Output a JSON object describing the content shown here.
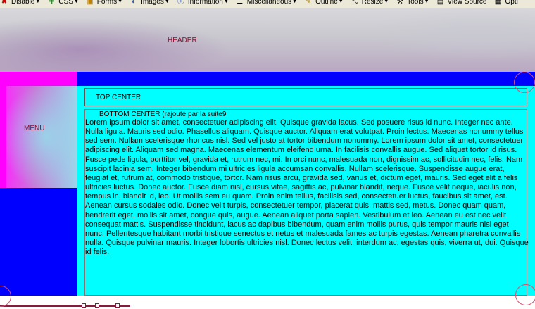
{
  "toolbar": {
    "items": [
      {
        "label": "Disable",
        "icon": "disable-icon"
      },
      {
        "label": "CSS",
        "icon": "css-icon"
      },
      {
        "label": "Forms",
        "icon": "forms-icon"
      },
      {
        "label": "Images",
        "icon": "images-icon"
      },
      {
        "label": "Information",
        "icon": "information-icon"
      },
      {
        "label": "Miscellaneous",
        "icon": "miscellaneous-icon"
      },
      {
        "label": "Outline",
        "icon": "outline-icon"
      },
      {
        "label": "Resize",
        "icon": "resize-icon"
      },
      {
        "label": "Tools",
        "icon": "tools-icon"
      },
      {
        "label": "View Source",
        "icon": "view-source-icon"
      },
      {
        "label": "Opti",
        "icon": "options-icon"
      }
    ]
  },
  "header": {
    "label": "HEADER"
  },
  "menu": {
    "label": "MENU"
  },
  "top_center": {
    "label": "TOP CENTER"
  },
  "bottom_center": {
    "title": "BOTTOM CENTER (rajouté par la suite9",
    "text": "Lorem ipsum dolor sit amet, consectetuer adipiscing elit. Quisque gravida lacus. Sed posuere risus id nunc. Integer nec ante. Nulla ligula. Mauris sed odio. Phasellus aliquam. Quisque auctor. Aliquam erat volutpat. Proin lectus. Maecenas nonummy tellus sed sem. Nullam scelerisque rhoncus nisl. Sed vel justo at tortor bibendum nonummy. Lorem ipsum dolor sit amet, consectetuer adipiscing elit. Aliquam sed magna. Maecenas elementum eleifend urna. In facilisis convallis augue. Sed aliquet tortor id risus. Fusce pede ligula, porttitor vel, gravida et, rutrum nec, mi. In orci nunc, malesuada non, dignissim ac, sollicitudin nec, felis. Nam suscipit lacinia sem. Integer bibendum mi ultricies ligula accumsan convallis. Nullam scelerisque. Suspendisse augue erat, feugiat et, rutrum at, commodo tristique, tortor. Nam risus arcu, gravida sed, varius et, dictum eget, mauris. Sed eget elit a felis ultricies luctus. Donec auctor. Fusce diam nisl, cursus vitae, sagittis ac, pulvinar blandit, neque. Fusce velit neque, iaculis non, tempus in, blandit id, leo. Ut mollis sem eu quam. Proin enim tellus, facilisis sed, consectetuer luctus, faucibus sit amet, est. Aenean cursus sodales odio. Donec velit turpis, consectetuer tempor, placerat quis, mattis sed, metus. Donec quam quam, hendrerit eget, mollis sit amet, congue quis, augue. Aenean aliquet porta sapien. Vestibulum et leo. Aenean eu est nec velit consequat mattis. Suspendisse tincidunt, lacus ac dapibus bibendum, quam enim mollis purus, quis tempor mauris nisl eget nunc. Pellentesque habitant morbi tristique senectus et netus et malesuada fames ac turpis egestas. Aenean pharetra convallis nulla. Quisque pulvinar mauris. Integer lobortis ultricies nisl. Donec lectus velit, interdum ac, egestas quis, viverra ut, dui. Quisque id felis."
  },
  "colors": {
    "blue": "#0000ff",
    "cyan": "#00ffff",
    "magenta": "#ff00ff",
    "label": "#8b0f2e"
  }
}
